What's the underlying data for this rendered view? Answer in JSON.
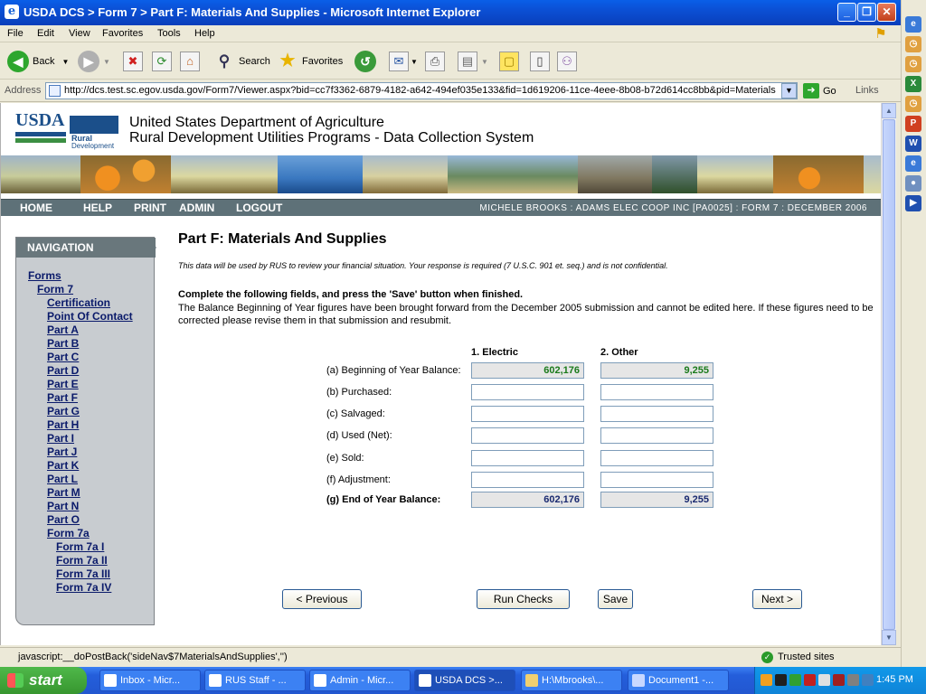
{
  "window": {
    "title": "USDA DCS > Form 7 > Part F: Materials And Supplies - Microsoft Internet Explorer",
    "controls": {
      "minimize": "_",
      "maximize": "❐",
      "close": "✕"
    }
  },
  "menu": [
    "File",
    "Edit",
    "View",
    "Favorites",
    "Tools",
    "Help"
  ],
  "toolbar": {
    "back": "Back",
    "search": "Search",
    "favorites": "Favorites"
  },
  "address": {
    "label": "Address",
    "url": "http://dcs.test.sc.egov.usda.gov/Form7/Viewer.aspx?bid=cc7f3362-6879-4182-a642-494ef035e133&fid=1d619206-11ce-4eee-8b08-b72d614cc8bb&pid=Materials",
    "go": "Go",
    "links": "Links"
  },
  "header": {
    "logo_usda": "USDA",
    "logo_rd1": "Rural",
    "logo_rd2": "Development",
    "line1": "United States Department of Agriculture",
    "line2": "Rural Development Utilities Programs - Data Collection System"
  },
  "topnav": {
    "items": [
      "HOME",
      "HELP",
      "PRINT",
      "ADMIN",
      "LOGOUT"
    ],
    "user_info": "MICHELE BROOKS : ADAMS ELEC COOP INC [PA0025] : FORM 7 : DECEMBER 2006"
  },
  "navigation": {
    "heading": "NAVIGATION",
    "items": [
      "Forms",
      "Form 7",
      "Certification",
      "Point Of Contact",
      "Part A",
      "Part B",
      "Part C",
      "Part D",
      "Part E",
      "Part F",
      "Part G",
      "Part H",
      "Part I",
      "Part J",
      "Part K",
      "Part L",
      "Part M",
      "Part N",
      "Part O",
      "Form 7a",
      "Form 7a I",
      "Form 7a II",
      "Form 7a III",
      "Form 7a IV"
    ]
  },
  "main": {
    "title": "Part F: Materials And Supplies",
    "disclaimer": "This data will be used by RUS to review your financial situation. Your response is required (7 U.S.C. 901 et. seq.) and is not confidential.",
    "instruction": "Complete the following fields, and press the 'Save' button when finished.",
    "note": "The Balance Beginning of Year figures have been brought forward from the December 2005 submission and cannot be edited here. If these figures need to be corrected please revise them in that submission and resubmit.",
    "columns": [
      "1. Electric",
      "2. Other"
    ],
    "rows": [
      {
        "label": "(a) Beginning of Year Balance:",
        "electric": "602,176",
        "other": "9,255"
      },
      {
        "label": "(b) Purchased:",
        "electric": "",
        "other": ""
      },
      {
        "label": "(c) Salvaged:",
        "electric": "",
        "other": ""
      },
      {
        "label": "(d) Used (Net):",
        "electric": "",
        "other": ""
      },
      {
        "label": "(e) Sold:",
        "electric": "",
        "other": ""
      },
      {
        "label": "(f) Adjustment:",
        "electric": "",
        "other": ""
      },
      {
        "label": "(g) End of Year Balance:",
        "electric": "602,176",
        "other": "9,255"
      }
    ],
    "buttons": {
      "previous": "< Previous",
      "run_checks": "Run Checks",
      "save": "Save",
      "next": "Next >"
    }
  },
  "status": {
    "text": "javascript:__doPostBack('sideNav$7MaterialsAndSupplies','')",
    "zone": "Trusted sites"
  },
  "taskbar": {
    "start": "start",
    "tasks": [
      "Inbox - Micr...",
      "RUS Staff - ...",
      "Admin - Micr...",
      "USDA DCS >...",
      "H:\\Mbrooks\\...",
      "Document1 -..."
    ],
    "clock": "1:45 PM"
  },
  "colors": {
    "nav_bar": "#5e7178",
    "nav_panel": "#c8ccd0",
    "title_blue": "#0b4fd4",
    "green_value": "#1a7a1a",
    "navy_value": "#1a2a70"
  }
}
